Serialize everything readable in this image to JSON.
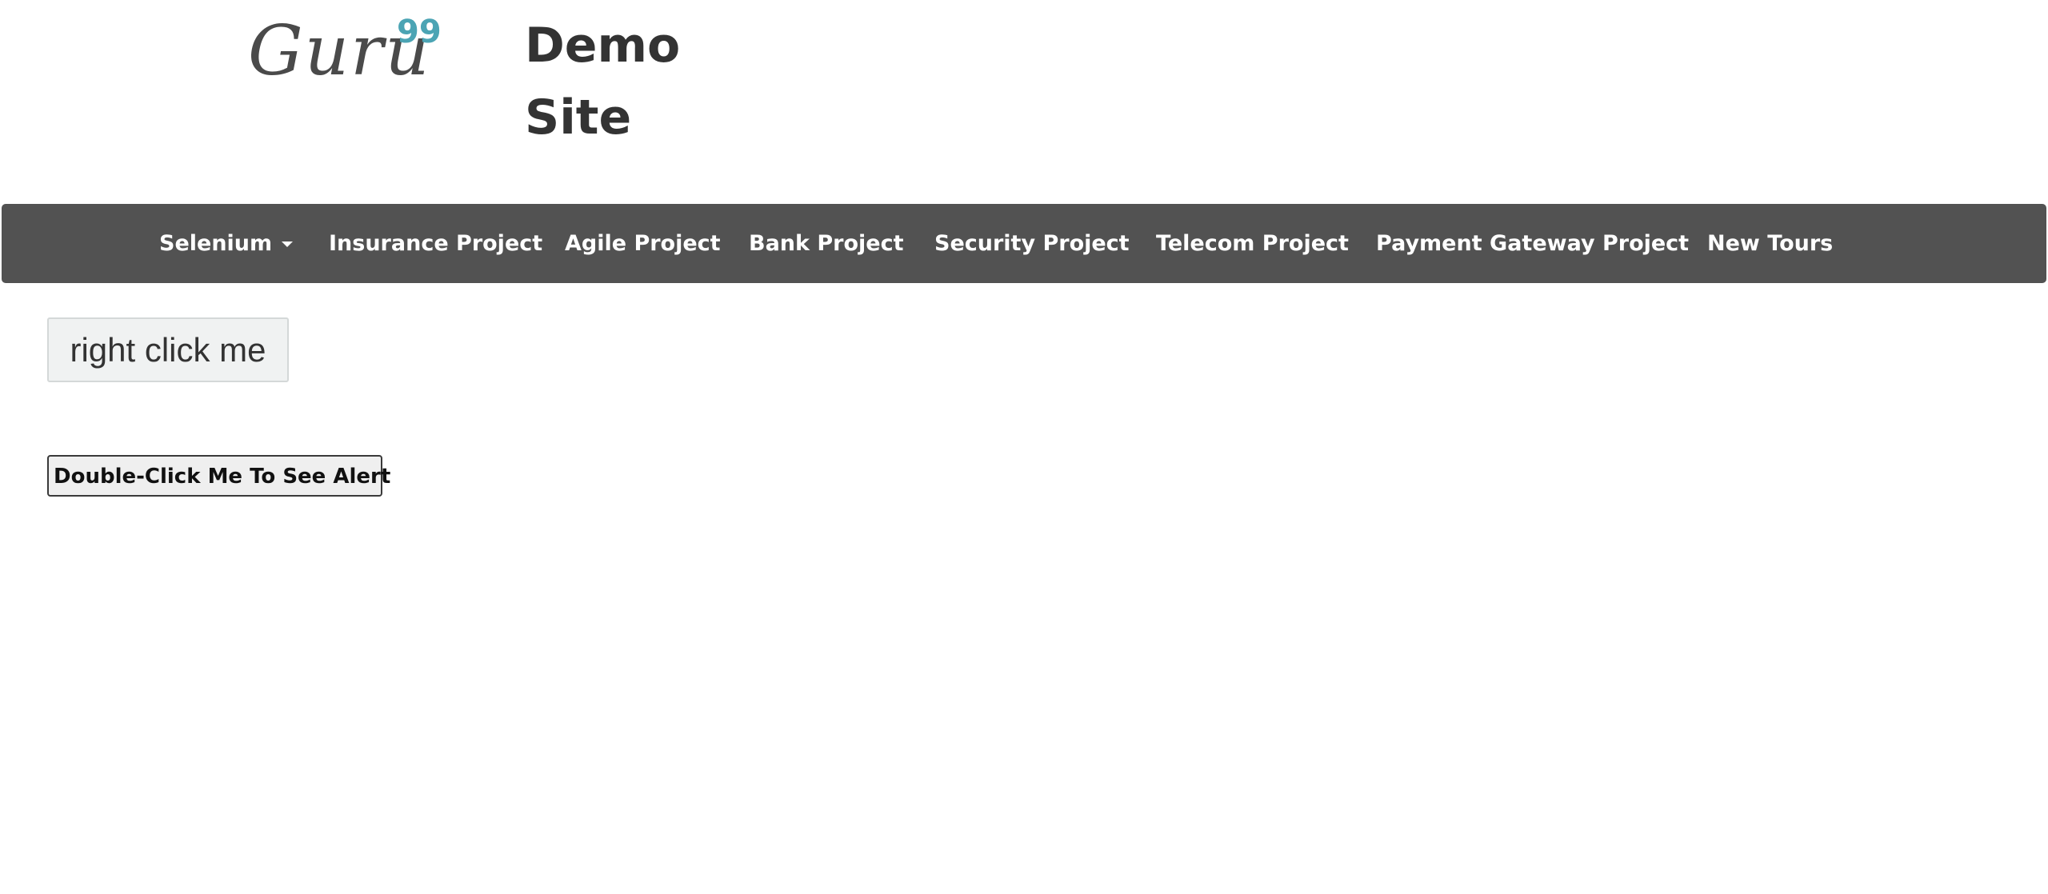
{
  "header": {
    "logo_text": "Guru",
    "logo_superscript": "99",
    "site_title": "Demo Site"
  },
  "nav": {
    "items": [
      {
        "label": "Selenium",
        "has_dropdown": true
      },
      {
        "label": "Insurance Project"
      },
      {
        "label": "Agile Project"
      },
      {
        "label": "Bank Project"
      },
      {
        "label": "Security Project"
      },
      {
        "label": "Telecom Project"
      },
      {
        "label": "Payment Gateway Project"
      },
      {
        "label": "New Tours"
      }
    ]
  },
  "main": {
    "right_click_button": "right click me",
    "double_click_button": "Double-Click Me To See Alert"
  },
  "colors": {
    "navbar_bg": "#525252",
    "logo_accent": "#4ba4b4",
    "heading_text": "#333333"
  }
}
